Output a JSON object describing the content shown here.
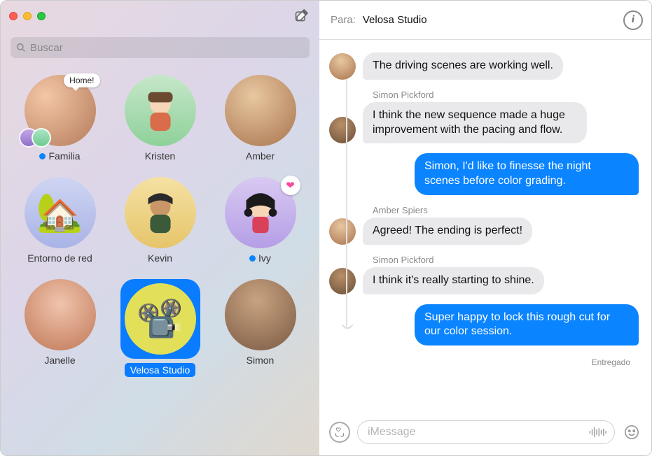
{
  "sidebar": {
    "search_placeholder": "Buscar",
    "compose_label": "Compose",
    "speech_bubble_text": "Home!",
    "chats": [
      {
        "label": "Familia",
        "unread": true
      },
      {
        "label": "Kristen",
        "unread": false
      },
      {
        "label": "Amber",
        "unread": false
      },
      {
        "label": "Entorno de red",
        "unread": false
      },
      {
        "label": "Kevin",
        "unread": false
      },
      {
        "label": "Ivy",
        "unread": true
      },
      {
        "label": "Janelle",
        "unread": false
      },
      {
        "label": "Velosa Studio",
        "unread": false,
        "selected": true
      },
      {
        "label": "Simon",
        "unread": false
      }
    ]
  },
  "header": {
    "para_label": "Para:",
    "recipient": "Velosa Studio"
  },
  "thread": {
    "messages": [
      {
        "from": "incoming",
        "sender": null,
        "text": "The driving scenes are working well."
      },
      {
        "from": "incoming",
        "sender": "Simon Pickford",
        "text": "I think the new sequence made a huge improvement with the pacing and flow."
      },
      {
        "from": "outgoing",
        "sender": null,
        "text": "Simon, I'd like to finesse the night scenes before color grading."
      },
      {
        "from": "incoming",
        "sender": "Amber Spiers",
        "text": "Agreed! The ending is perfect!"
      },
      {
        "from": "incoming",
        "sender": "Simon Pickford",
        "text": "I think it's really starting to shine."
      },
      {
        "from": "outgoing",
        "sender": null,
        "text": "Super happy to lock this rough cut for our color session."
      }
    ],
    "delivered_label": "Entregado"
  },
  "composer": {
    "placeholder": "iMessage"
  },
  "icons": {
    "search": "search-icon",
    "compose": "compose-icon",
    "info": "info-icon",
    "apps": "apps-icon",
    "voice": "voice-icon",
    "emoji": "emoji-icon",
    "heart": "heart-icon",
    "house": "house-icon",
    "projector": "projector-icon"
  },
  "colors": {
    "accent_blue": "#0a84ff",
    "bubble_grey": "#e9e9eb"
  }
}
